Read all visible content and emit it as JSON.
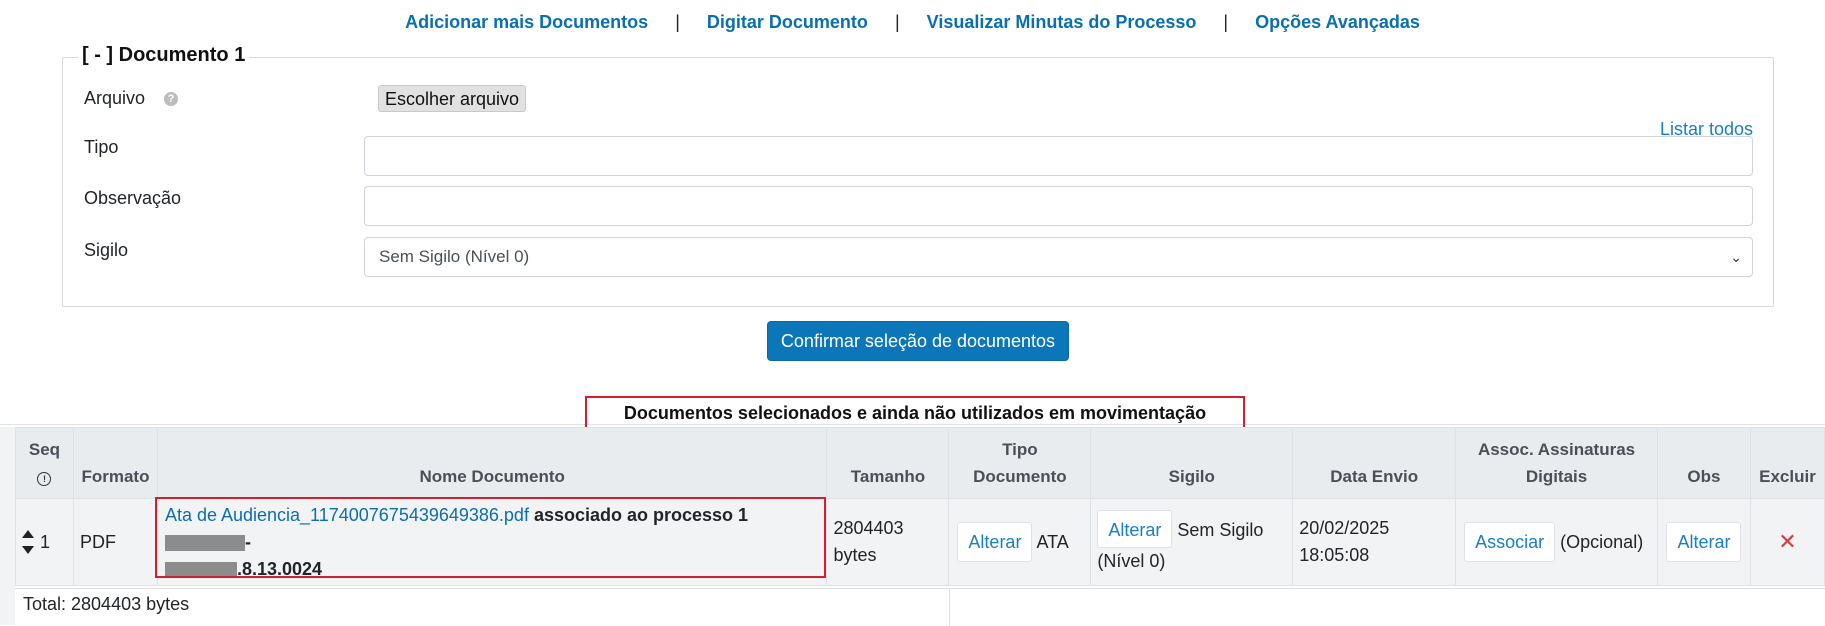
{
  "toplinks": {
    "add_more": "Adicionar mais Documentos",
    "type_doc": "Digitar Documento",
    "view_drafts": "Visualizar Minutas do Processo",
    "advanced": "Opções Avançadas",
    "separator": "|"
  },
  "document_form": {
    "legend": "[ - ] Documento 1",
    "arquivo_label": "Arquivo",
    "help_glyph": "?",
    "file_button": "Escolher arquivo",
    "listar_todos": "Listar todos",
    "tipo_label": "Tipo",
    "tipo_value": "",
    "observacao_label": "Observação",
    "observacao_value": "",
    "sigilo_label": "Sigilo",
    "sigilo_value": "Sem Sigilo (Nível 0)"
  },
  "confirm_button": "Confirmar seleção de documentos",
  "section_title": "Documentos selecionados e ainda não utilizados em movimentação",
  "table": {
    "headers": {
      "seq": "Seq",
      "formato": "Formato",
      "nome": "Nome Documento",
      "tamanho": "Tamanho",
      "tipo_line1": "Tipo",
      "tipo_line2": "Documento",
      "sigilo": "Sigilo",
      "data_envio": "Data Envio",
      "assoc_line1": "Assoc. Assinaturas",
      "assoc_line2": "Digitais",
      "obs": "Obs",
      "excluir": "Excluir"
    },
    "rows": [
      {
        "seq": "1",
        "formato": "PDF",
        "file_name": "Ata de Audiencia_1174007675439649386.pdf",
        "assoc_text": "associado ao processo 1",
        "process_tail": ".8.13.0024",
        "tamanho_line1": "2804403",
        "tamanho_line2": "bytes",
        "tipo_button": "Alterar",
        "tipo_value": "ATA",
        "sigilo_button": "Alterar",
        "sigilo_value_1": "Sem Sigilo",
        "sigilo_value_2": "(Nível 0)",
        "data_line1": "20/02/2025",
        "data_line2": "18:05:08",
        "assoc_button": "Associar",
        "assoc_note": "(Opcional)",
        "obs_button": "Alterar",
        "delete_glyph": "✕"
      }
    ],
    "total": "Total: 2804403 bytes"
  },
  "colors": {
    "link": "#0a6fb0",
    "primary_button": "#0b76b8",
    "highlight_border": "#d01f2e",
    "header_bg": "#e9ecef"
  }
}
